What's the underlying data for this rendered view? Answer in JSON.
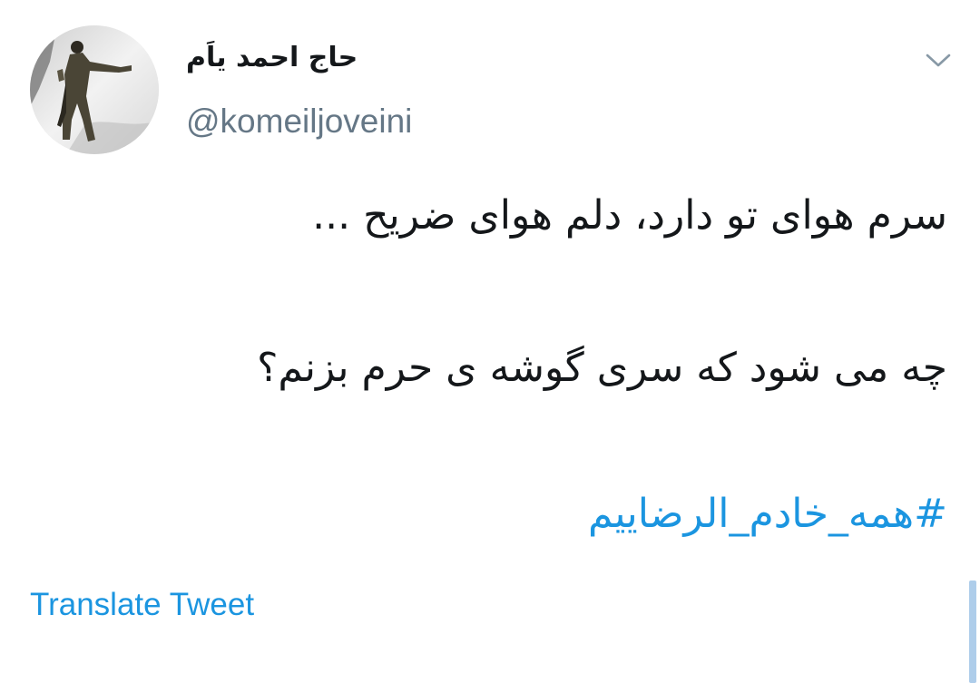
{
  "author": {
    "display_name": "حاج احمد یاَم",
    "handle": "@komeiljoveini"
  },
  "tweet": {
    "lines": [
      "سرم هوای تو دارد، دلم هوای ضریح ...",
      "چه می شود که سری گوشه ی حرم بزنم؟"
    ],
    "hashtag": "#همه_خادم_الرضاییم"
  },
  "actions": {
    "translate_label": "Translate Tweet",
    "menu_icon": "chevron-down-icon"
  },
  "colors": {
    "text": "#14171a",
    "secondary": "#657786",
    "link": "#1b95e0"
  }
}
